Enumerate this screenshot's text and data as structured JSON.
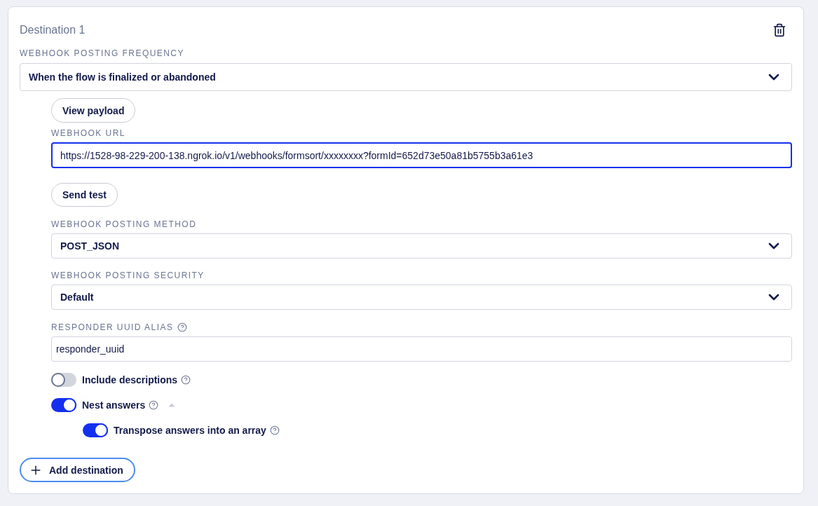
{
  "destinations": [
    {
      "title": "Destination 1",
      "frequency": {
        "label": "WEBHOOK POSTING FREQUENCY",
        "value": "When the flow is finalized or abandoned"
      },
      "view_payload_button": "View payload",
      "webhook_url": {
        "label": "WEBHOOK URL",
        "value": "https://1528-98-229-200-138.ngrok.io/v1/webhooks/formsort/xxxxxxxx?formId=652d73e50a81b5755b3a61e3",
        "focused": true
      },
      "send_test_button": "Send test",
      "posting_method": {
        "label": "WEBHOOK POSTING METHOD",
        "value": "POST_JSON"
      },
      "posting_security": {
        "label": "WEBHOOK POSTING SECURITY",
        "value": "Default"
      },
      "responder_uuid_alias": {
        "label": "RESPONDER UUID ALIAS",
        "value": "responder_uuid"
      },
      "toggles": [
        {
          "label": "Include descriptions",
          "on": false
        },
        {
          "label": "Nest answers",
          "on": true,
          "expanded": true,
          "children": [
            {
              "label": "Transpose answers into an array",
              "on": true
            }
          ]
        }
      ]
    }
  ],
  "add_destination_button": "Add destination"
}
